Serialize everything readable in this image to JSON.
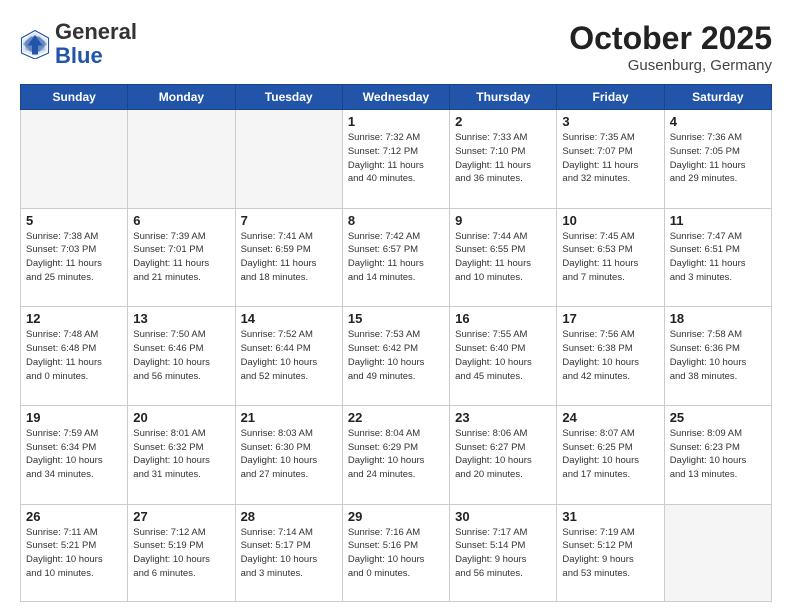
{
  "logo": {
    "general": "General",
    "blue": "Blue"
  },
  "header": {
    "month": "October 2025",
    "location": "Gusenburg, Germany"
  },
  "weekdays": [
    "Sunday",
    "Monday",
    "Tuesday",
    "Wednesday",
    "Thursday",
    "Friday",
    "Saturday"
  ],
  "weeks": [
    [
      {
        "day": "",
        "info": ""
      },
      {
        "day": "",
        "info": ""
      },
      {
        "day": "",
        "info": ""
      },
      {
        "day": "1",
        "info": "Sunrise: 7:32 AM\nSunset: 7:12 PM\nDaylight: 11 hours\nand 40 minutes."
      },
      {
        "day": "2",
        "info": "Sunrise: 7:33 AM\nSunset: 7:10 PM\nDaylight: 11 hours\nand 36 minutes."
      },
      {
        "day": "3",
        "info": "Sunrise: 7:35 AM\nSunset: 7:07 PM\nDaylight: 11 hours\nand 32 minutes."
      },
      {
        "day": "4",
        "info": "Sunrise: 7:36 AM\nSunset: 7:05 PM\nDaylight: 11 hours\nand 29 minutes."
      }
    ],
    [
      {
        "day": "5",
        "info": "Sunrise: 7:38 AM\nSunset: 7:03 PM\nDaylight: 11 hours\nand 25 minutes."
      },
      {
        "day": "6",
        "info": "Sunrise: 7:39 AM\nSunset: 7:01 PM\nDaylight: 11 hours\nand 21 minutes."
      },
      {
        "day": "7",
        "info": "Sunrise: 7:41 AM\nSunset: 6:59 PM\nDaylight: 11 hours\nand 18 minutes."
      },
      {
        "day": "8",
        "info": "Sunrise: 7:42 AM\nSunset: 6:57 PM\nDaylight: 11 hours\nand 14 minutes."
      },
      {
        "day": "9",
        "info": "Sunrise: 7:44 AM\nSunset: 6:55 PM\nDaylight: 11 hours\nand 10 minutes."
      },
      {
        "day": "10",
        "info": "Sunrise: 7:45 AM\nSunset: 6:53 PM\nDaylight: 11 hours\nand 7 minutes."
      },
      {
        "day": "11",
        "info": "Sunrise: 7:47 AM\nSunset: 6:51 PM\nDaylight: 11 hours\nand 3 minutes."
      }
    ],
    [
      {
        "day": "12",
        "info": "Sunrise: 7:48 AM\nSunset: 6:48 PM\nDaylight: 11 hours\nand 0 minutes."
      },
      {
        "day": "13",
        "info": "Sunrise: 7:50 AM\nSunset: 6:46 PM\nDaylight: 10 hours\nand 56 minutes."
      },
      {
        "day": "14",
        "info": "Sunrise: 7:52 AM\nSunset: 6:44 PM\nDaylight: 10 hours\nand 52 minutes."
      },
      {
        "day": "15",
        "info": "Sunrise: 7:53 AM\nSunset: 6:42 PM\nDaylight: 10 hours\nand 49 minutes."
      },
      {
        "day": "16",
        "info": "Sunrise: 7:55 AM\nSunset: 6:40 PM\nDaylight: 10 hours\nand 45 minutes."
      },
      {
        "day": "17",
        "info": "Sunrise: 7:56 AM\nSunset: 6:38 PM\nDaylight: 10 hours\nand 42 minutes."
      },
      {
        "day": "18",
        "info": "Sunrise: 7:58 AM\nSunset: 6:36 PM\nDaylight: 10 hours\nand 38 minutes."
      }
    ],
    [
      {
        "day": "19",
        "info": "Sunrise: 7:59 AM\nSunset: 6:34 PM\nDaylight: 10 hours\nand 34 minutes."
      },
      {
        "day": "20",
        "info": "Sunrise: 8:01 AM\nSunset: 6:32 PM\nDaylight: 10 hours\nand 31 minutes."
      },
      {
        "day": "21",
        "info": "Sunrise: 8:03 AM\nSunset: 6:30 PM\nDaylight: 10 hours\nand 27 minutes."
      },
      {
        "day": "22",
        "info": "Sunrise: 8:04 AM\nSunset: 6:29 PM\nDaylight: 10 hours\nand 24 minutes."
      },
      {
        "day": "23",
        "info": "Sunrise: 8:06 AM\nSunset: 6:27 PM\nDaylight: 10 hours\nand 20 minutes."
      },
      {
        "day": "24",
        "info": "Sunrise: 8:07 AM\nSunset: 6:25 PM\nDaylight: 10 hours\nand 17 minutes."
      },
      {
        "day": "25",
        "info": "Sunrise: 8:09 AM\nSunset: 6:23 PM\nDaylight: 10 hours\nand 13 minutes."
      }
    ],
    [
      {
        "day": "26",
        "info": "Sunrise: 7:11 AM\nSunset: 5:21 PM\nDaylight: 10 hours\nand 10 minutes."
      },
      {
        "day": "27",
        "info": "Sunrise: 7:12 AM\nSunset: 5:19 PM\nDaylight: 10 hours\nand 6 minutes."
      },
      {
        "day": "28",
        "info": "Sunrise: 7:14 AM\nSunset: 5:17 PM\nDaylight: 10 hours\nand 3 minutes."
      },
      {
        "day": "29",
        "info": "Sunrise: 7:16 AM\nSunset: 5:16 PM\nDaylight: 10 hours\nand 0 minutes."
      },
      {
        "day": "30",
        "info": "Sunrise: 7:17 AM\nSunset: 5:14 PM\nDaylight: 9 hours\nand 56 minutes."
      },
      {
        "day": "31",
        "info": "Sunrise: 7:19 AM\nSunset: 5:12 PM\nDaylight: 9 hours\nand 53 minutes."
      },
      {
        "day": "",
        "info": ""
      }
    ]
  ]
}
